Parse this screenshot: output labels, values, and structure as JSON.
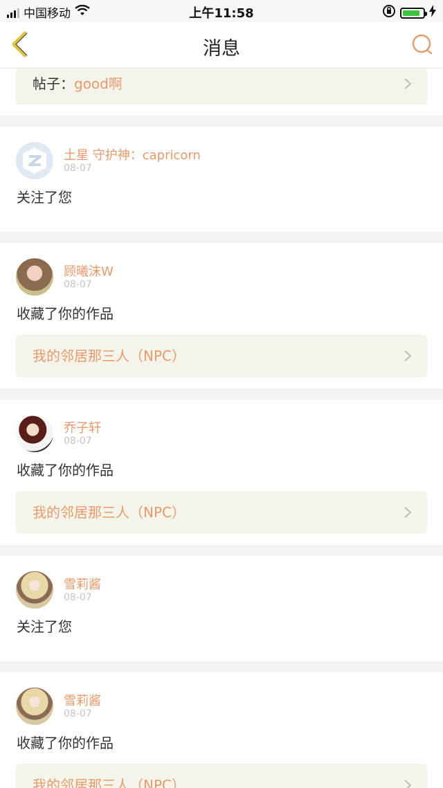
{
  "status_bar": {
    "carrier": "中国移动",
    "time": "上午11:58",
    "icons": [
      "signal-icon",
      "wifi-icon",
      "orientation-lock-icon",
      "battery-icon",
      "charging-icon"
    ]
  },
  "nav": {
    "title": "消息",
    "back_icon": "chevron-left-icon",
    "search_icon": "search-icon",
    "accent": "#e69a6c",
    "back_color": "#e0c341"
  },
  "top_item": {
    "label": "帖子：",
    "value": "good啊"
  },
  "items": [
    {
      "user": "土星 守护神：capricorn",
      "date": "08-07",
      "action": "关注了您",
      "link": null,
      "avatar": "default-avatar-icon"
    },
    {
      "user": "顾曦沫W",
      "date": "08-07",
      "action": "收藏了你的作品",
      "link": "我的邻居那三人（NPC）",
      "avatar": "user-avatar"
    },
    {
      "user": "乔子轩",
      "date": "08-07",
      "action": "收藏了你的作品",
      "link": "我的邻居那三人（NPC）",
      "avatar": "user-avatar"
    },
    {
      "user": "雪莉酱",
      "date": "08-07",
      "action": "关注了您",
      "link": null,
      "avatar": "user-avatar"
    },
    {
      "user": "雪莉酱",
      "date": "08-07",
      "action": "收藏了你的作品",
      "link": "我的邻居那三人（NPC）",
      "avatar": "user-avatar"
    }
  ]
}
